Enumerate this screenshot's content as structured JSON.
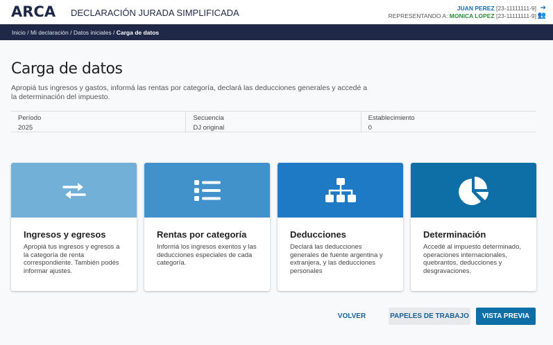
{
  "header": {
    "logo": "ARCA",
    "title": "DECLARACIÓN JURADA SIMPLIFICADA",
    "user_name": "JUAN PEREZ",
    "user_cuit": "[23-11111111-9]",
    "representing_label": "REPRESENTANDO A:",
    "represented_name": "MONICA LOPEZ",
    "represented_cuit": "[23-11111111-9]"
  },
  "breadcrumb": [
    "Inicio",
    "Mi declaración",
    "Datos iniciales",
    "Carga de datos"
  ],
  "page": {
    "title": "Carga de datos",
    "description": "Apropiá tus ingresos y gastos, informá las rentas por categoría, declará las deducciones generales y accedé a la determinación del impuesto."
  },
  "info": [
    {
      "label": "Período",
      "value": "2025"
    },
    {
      "label": "Secuencia",
      "value": "DJ original"
    },
    {
      "label": "Establecimiento",
      "value": "0"
    }
  ],
  "cards": [
    {
      "title": "Ingresos y egresos",
      "description": "Apropiá tus ingresos y egresos a la categoría de renta correspondiente. También podés informar ajustes.",
      "icon": "exchange-arrows-icon",
      "color": "#72b0d8"
    },
    {
      "title": "Rentas por categoría",
      "description": "Informá los ingresos exentos y las deducciones especiales de cada categoría.",
      "icon": "list-icon",
      "color": "#4191cb"
    },
    {
      "title": "Deducciones",
      "description": "Declará las deducciones generales de fuente argentina y extranjera, y las deducciones personales",
      "icon": "sitemap-icon",
      "color": "#1e7ac4"
    },
    {
      "title": "Determinación",
      "description": "Accedé al impuesto determinado, operaciones internacionales, quebrantos, deducciones y desgravaciones.",
      "icon": "pie-chart-icon",
      "color": "#0e6fa7"
    }
  ],
  "actions": {
    "back": "VOLVER",
    "workpapers": "PAPELES DE TRABAJO",
    "preview": "VISTA PREVIA"
  }
}
